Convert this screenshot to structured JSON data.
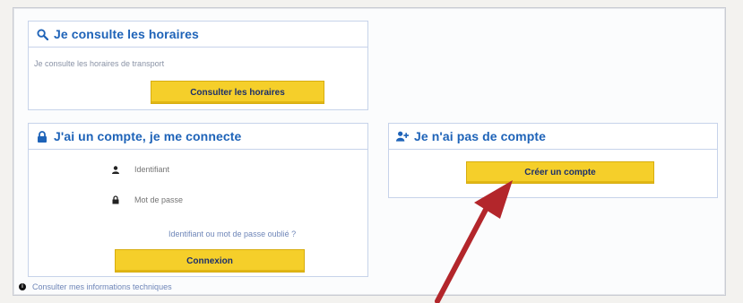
{
  "horaires": {
    "title": "Je consulte les horaires",
    "description": "Je consulte les horaires de transport",
    "button_label": "Consulter les horaires"
  },
  "login": {
    "title": "J'ai un compte, je me connecte",
    "identifier_placeholder": "Identifiant",
    "password_placeholder": "Mot de passe",
    "forgot_link": "Identifiant ou mot de passe oublié ?",
    "button_label": "Connexion"
  },
  "signup": {
    "title": "Je n'ai pas de compte",
    "button_label": "Créer un compte"
  },
  "footer": {
    "info_link": "Consulter mes informations techniques"
  },
  "colors": {
    "accent": "#1e63b8",
    "button": "#f5cf2a",
    "annotation_arrow": "#b3262b"
  }
}
